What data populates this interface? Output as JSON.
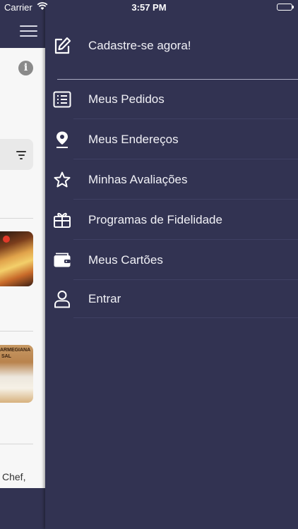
{
  "status_bar": {
    "carrier": "Carrier",
    "time": "3:57 PM",
    "wifi_icon": "wifi-icon",
    "battery_icon": "battery-icon",
    "battery_level": 1.0
  },
  "background": {
    "menu_icon": "hamburger-icon",
    "info_icon": "info-icon",
    "info_glyph": "i",
    "filter_icon": "filter-icon",
    "food2_caption": "ARMEGIANA\n SAL",
    "partial_text": "Chef,"
  },
  "drawer": {
    "colors": {
      "background": "#323352",
      "text": "#f1f1f6"
    },
    "register": {
      "label": "Cadastre-se agora!",
      "icon": "edit-icon"
    },
    "items": [
      {
        "label": "Meus Pedidos",
        "icon": "list-icon"
      },
      {
        "label": "Meus Endereços",
        "icon": "location-pin-icon"
      },
      {
        "label": "Minhas Avaliações",
        "icon": "star-icon"
      },
      {
        "label": "Programas de Fidelidade",
        "icon": "gift-icon"
      },
      {
        "label": "Meus Cartões",
        "icon": "wallet-icon"
      },
      {
        "label": "Entrar",
        "icon": "user-icon"
      }
    ]
  }
}
